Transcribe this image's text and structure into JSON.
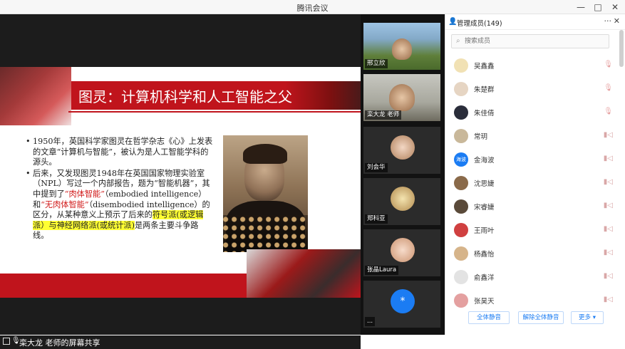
{
  "window": {
    "title": "腾讯会议",
    "controls": [
      "—",
      "□",
      "✕"
    ]
  },
  "slide": {
    "title": "图灵：计算机科学和人工智能之父",
    "bullet1": "1950年，英国科学家图灵在哲学杂志《心》上发表的文章“计算机与智能”，被认为是人工智能学科的源头。",
    "bullet2_a": "后来，又发现图灵1948年在英国国家物理实验室（NPL）写过一个内部报告，题为“智能机器”，其中提到了",
    "bullet2_red1": "“肉体智能”",
    "bullet2_b": "（embodied intelligence）和",
    "bullet2_red2": "“无肉体智能”",
    "bullet2_c": "（disembodied intelligence）的区分，从某种意义上预示了后来的",
    "bullet2_hl": "符号派(或逻辑派）与神经网络派(或统计派)",
    "bullet2_d": "是两条主要斗争路线。"
  },
  "share": {
    "label": "栾大龙  老师的屏幕共享"
  },
  "strip": {
    "tiles": [
      {
        "name": "邢立欣"
      },
      {
        "name": "栾大龙  老师"
      },
      {
        "name": "刘会华"
      },
      {
        "name": "郑科亚"
      },
      {
        "name": "张晶Laura"
      },
      {
        "name": "...",
        "avatar_text": "*"
      }
    ]
  },
  "panel": {
    "title": "管理成员(149)",
    "more_icon": "···",
    "close_icon": "✕",
    "search_placeholder": "搜索成员",
    "members": [
      {
        "name": "吴鑫鑫",
        "status": "mic-muted"
      },
      {
        "name": "朱楚群",
        "status": "mic-muted"
      },
      {
        "name": "朱佳倩",
        "status": "mic-muted"
      },
      {
        "name": "常玥",
        "status": "cam-off"
      },
      {
        "name": "金海波",
        "status": "cam-off",
        "badge": "海波"
      },
      {
        "name": "沈思婕",
        "status": "cam-off"
      },
      {
        "name": "宋睿婕",
        "status": "cam-off"
      },
      {
        "name": "王雨叶",
        "status": "cam-off"
      },
      {
        "name": "杨鑫怡",
        "status": "cam-off"
      },
      {
        "name": "俞鑫洋",
        "status": "cam-off"
      },
      {
        "name": "张昊天",
        "status": "cam-off"
      }
    ],
    "buttons": {
      "mute_all": "全体静音",
      "unmute_all": "解除全体静音",
      "more": "更多 ▾"
    }
  }
}
